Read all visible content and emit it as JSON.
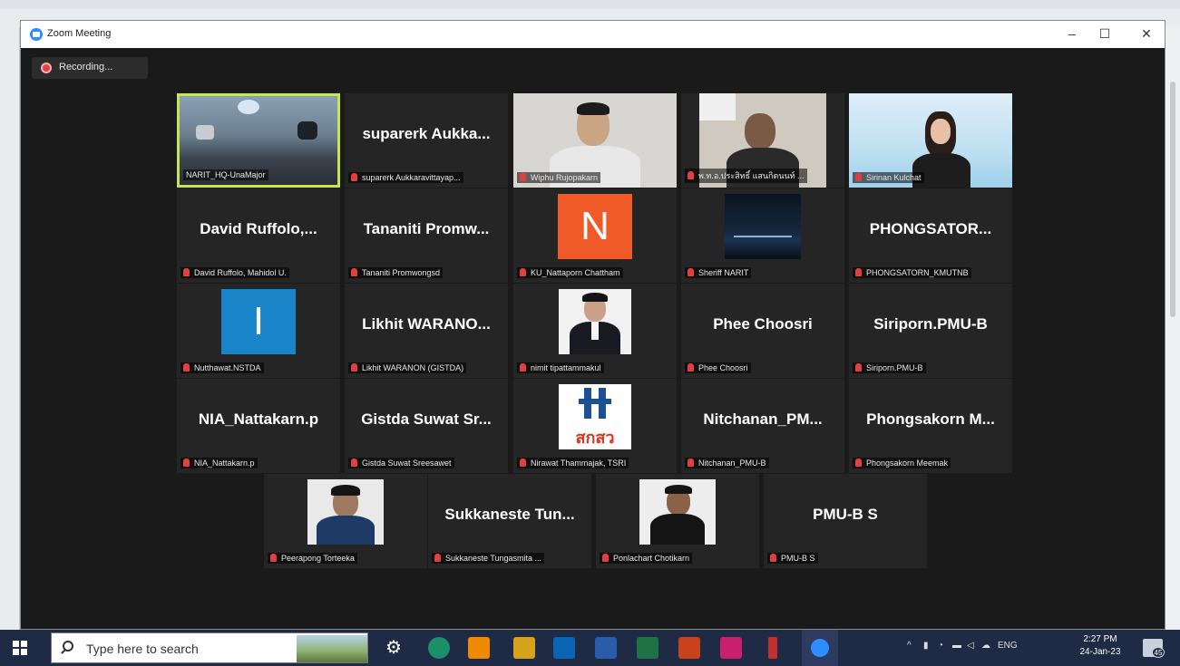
{
  "window": {
    "title": "Zoom Meeting",
    "controls": {
      "minimize": "–",
      "maximize": "☐",
      "close": "✕"
    }
  },
  "recording": {
    "label": "Recording..."
  },
  "tiles": [
    {
      "big": "",
      "label": "NARIT_HQ-UnaMajor",
      "kind": "video-room"
    },
    {
      "big": "suparerk Aukka...",
      "label": "suparerk Aukkaravittayap...",
      "kind": "name"
    },
    {
      "big": "",
      "label": "Wiphu Rujopakarn",
      "kind": "video-man"
    },
    {
      "big": "",
      "label": "พ.ท.อ.ประสิทธิ์ แสนกิตนนท์ ...",
      "kind": "video-man2"
    },
    {
      "big": "",
      "label": "Sirinan Kulchat",
      "kind": "video-woman"
    },
    {
      "big": "David Ruffolo,...",
      "label": "David Ruffolo, Mahidol U.",
      "kind": "name"
    },
    {
      "big": "Tananiti Promw...",
      "label": "Tananiti Promwongsd",
      "kind": "name"
    },
    {
      "big": "N",
      "label": "KU_Nattaporn Chattham",
      "kind": "letter-orange"
    },
    {
      "big": "",
      "label": "Sheriff NARIT",
      "kind": "image-night"
    },
    {
      "big": "PHONGSATOR...",
      "label": "PHONGSATORN_KMUTNB",
      "kind": "name"
    },
    {
      "big": "I",
      "label": "Nutthawat.NSTDA",
      "kind": "letter-blue"
    },
    {
      "big": "Likhit WARANO...",
      "label": "Likhit WARANON (GISTDA)",
      "kind": "name"
    },
    {
      "big": "",
      "label": "nimit tipattammakul",
      "kind": "photo-suit"
    },
    {
      "big": "Phee Choosri",
      "label": "Phee Choosri",
      "kind": "name"
    },
    {
      "big": "Siriporn.PMU-B",
      "label": "Siriporn.PMU-B",
      "kind": "name"
    },
    {
      "big": "NIA_Nattakarn.p",
      "label": "NIA_Nattakarn.p",
      "kind": "name"
    },
    {
      "big": "Gistda Suwat Sr...",
      "label": "Gistda Suwat Sreesawet",
      "kind": "name"
    },
    {
      "big": "สกสว",
      "label": "Nirawat Thammajak, TSRI",
      "kind": "logo-tsri"
    },
    {
      "big": "Nitchanan_PM...",
      "label": "Nitchanan_PMU-B",
      "kind": "name"
    },
    {
      "big": "Phongsakorn M...",
      "label": "Phongsakorn Meemak",
      "kind": "name"
    },
    {
      "big": "",
      "label": "Peerapong Torteeka",
      "kind": "photo-man-blue"
    },
    {
      "big": "Sukkaneste Tun...",
      "label": "Sukkaneste Tungasmita ...",
      "kind": "name"
    },
    {
      "big": "",
      "label": "Ponlachart Chotikarn",
      "kind": "photo-man-black"
    },
    {
      "big": "PMU-B S",
      "label": "PMU-B S",
      "kind": "name"
    }
  ],
  "taskbar": {
    "search_placeholder": "Type here to search",
    "language": "ENG",
    "time": "2:27 PM",
    "date": "24-Jan-23",
    "notifications": "45"
  }
}
